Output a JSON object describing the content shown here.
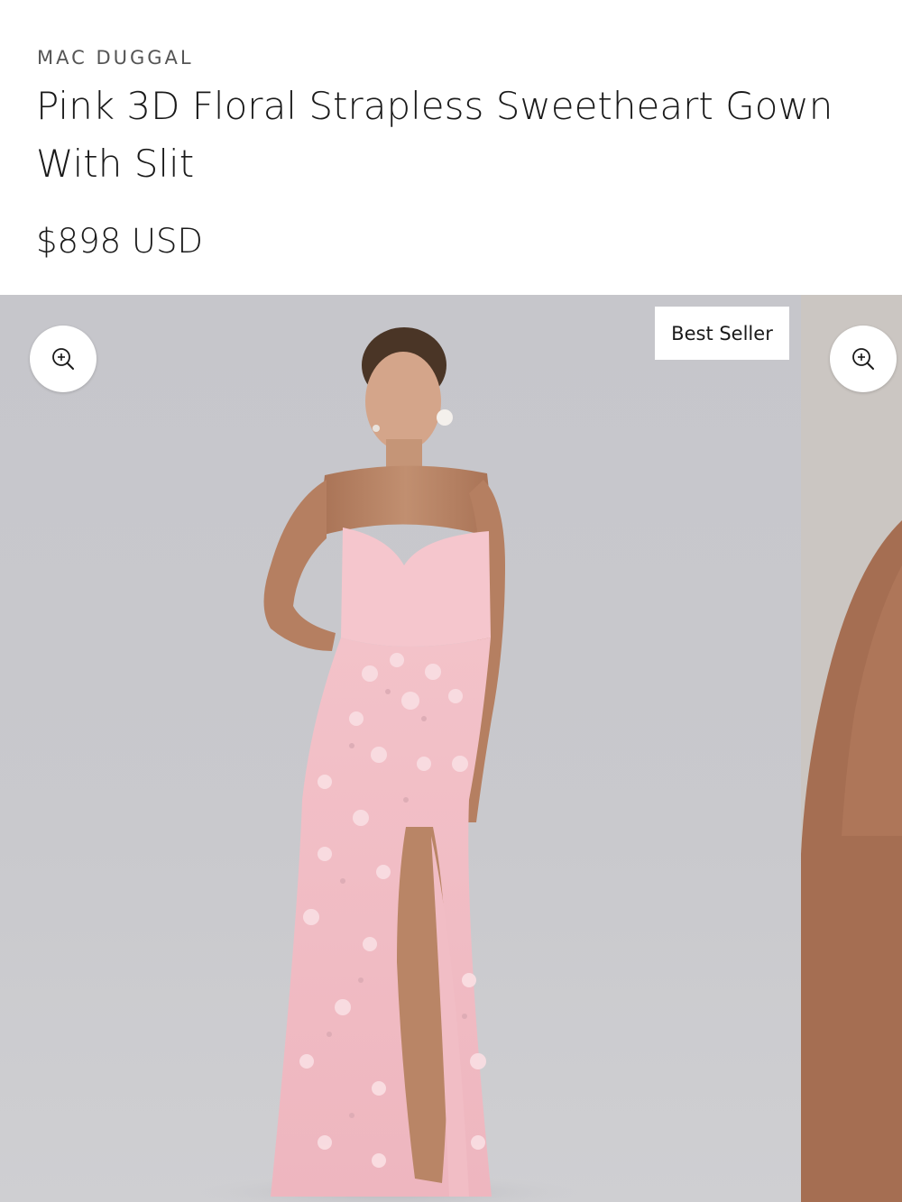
{
  "product": {
    "brand": "MAC DUGGAL",
    "title": "Pink 3D Floral Strapless Sweetheart Gown With Slit",
    "price": "$898 USD"
  },
  "gallery": {
    "badge": "Best Seller",
    "zoom_icon": "zoom-in-icon",
    "colors": {
      "dress": "#f2bcc4",
      "backdrop": "#c8c8cc",
      "skin": "#b98566"
    }
  }
}
